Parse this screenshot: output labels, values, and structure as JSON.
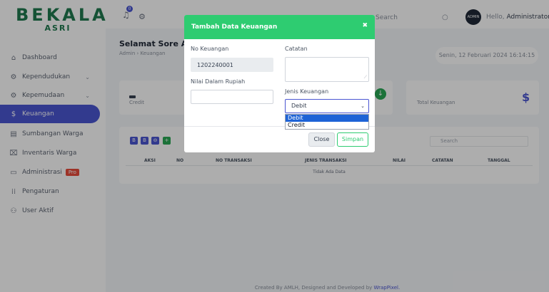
{
  "brand": {
    "name": "BEKALA",
    "tagline": "ASRI"
  },
  "sidebar": {
    "items": [
      {
        "label": "Dashboard",
        "icon": "home-icon",
        "glyph": "⌂"
      },
      {
        "label": "Kependudukan",
        "icon": "gear-icon",
        "glyph": "⚙",
        "chevron": "⌄"
      },
      {
        "label": "Kepemudaan",
        "icon": "gear-icon",
        "glyph": "⚙",
        "chevron": "⌄"
      },
      {
        "label": "Keuangan",
        "icon": "dollar-icon",
        "glyph": "$",
        "active": true
      },
      {
        "label": "Sumbangan Warga",
        "icon": "calendar-icon",
        "glyph": "▤"
      },
      {
        "label": "Inventaris Warga",
        "icon": "gift-icon",
        "glyph": "⌧"
      },
      {
        "label": "Administrasi",
        "icon": "document-icon",
        "glyph": "▭",
        "badge": "Pro"
      },
      {
        "label": "Pengaturan",
        "icon": "grid-icon",
        "glyph": "⁞⁞"
      },
      {
        "label": "User Aktif",
        "icon": "users-icon",
        "glyph": "⚇"
      }
    ]
  },
  "topbar": {
    "notif_count": "0",
    "search_placeholder": "Search",
    "avatar_text": "ADMIN",
    "greeting_prefix": "Hello,",
    "user_name": "Administrator"
  },
  "main": {
    "greeting": "Selamat Sore Ad",
    "breadcrumb": "Admin  ›  Keuangan",
    "date": "Senin, 12 Februari 2024 16:14:15",
    "cards": {
      "credit_label": "Credit",
      "total_label": "Total Keuangan",
      "dollar": "$"
    },
    "table": {
      "buttons": [
        "B",
        "B",
        "⊖",
        "+"
      ],
      "search_placeholder": "Search",
      "headers": [
        "AKSI",
        "NO",
        "NO TRANSAKSI",
        "JENIS TRANSAKSI",
        "NILAI",
        "CATATAN",
        "TANGGAL"
      ],
      "empty_text": "Tidak Ada Data"
    }
  },
  "footer": {
    "text": "Created By AMLH, Designed and Developed by",
    "link": "WrapPixel."
  },
  "modal": {
    "title": "Tambah Data Keuangan",
    "close_icon": "✖",
    "fields": {
      "no_keuangan_label": "No Keuangan",
      "no_keuangan_value": "1202240001",
      "nilai_label": "Nilai Dalam Rupiah",
      "nilai_value": "",
      "catatan_label": "Catatan",
      "catatan_value": "",
      "jenis_label": "Jenis Keuangan",
      "jenis_value": "Debit"
    },
    "dropdown_options": [
      "Debit",
      "Credit"
    ],
    "buttons": {
      "close": "Close",
      "save": "Simpan"
    }
  },
  "colors": {
    "primary": "#4b56d2",
    "success": "#2ecc71",
    "brand": "#1f7a4e"
  }
}
